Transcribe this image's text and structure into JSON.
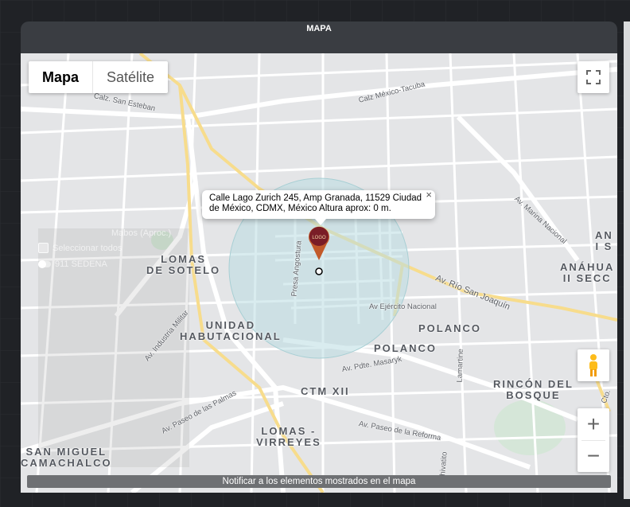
{
  "modal": {
    "title": "MAPA"
  },
  "map_type": {
    "map_label": "Mapa",
    "satellite_label": "Satélite",
    "active": "Mapa"
  },
  "info_window": {
    "line1": "Calle Lago Zurich 245, Amp Granada, 11529 Ciudad",
    "line2": "de México, CDMX, México Altura aprox: 0 m.",
    "close": "×"
  },
  "overlay": {
    "select_all": "Seleccionar todos",
    "layer": "911 SEDENA",
    "layer_label": "Mabos (Aproc.)"
  },
  "bottom_bar": {
    "label": "Notificar a los elementos mostrados en el mapa"
  },
  "zoom": {
    "in": "+",
    "out": "−"
  },
  "neighborhoods": [
    {
      "text": "LOMAS\nDE SOTELO"
    },
    {
      "text": "UNIDAD\nHABUTACIONAL"
    },
    {
      "text": "POLANCO"
    },
    {
      "text": "POLANCO"
    },
    {
      "text": "CTM XII"
    },
    {
      "text": "LOMAS -\nVIRREYES"
    },
    {
      "text": "SAN MIGUEL\nCAMACHALCO"
    },
    {
      "text": "RINCÓN DEL\nBOSQUE"
    },
    {
      "text": "ANÁHUA\nII SECC"
    },
    {
      "text": "AN\nI S"
    }
  ],
  "streets": [
    {
      "text": "Calz. San Esteban"
    },
    {
      "text": "Calz México-Tacuba"
    },
    {
      "text": "Av. Marina Nacional"
    },
    {
      "text": "Av. Río San Joaquín"
    },
    {
      "text": "Av Ejército Nacional"
    },
    {
      "text": "Presa Angostura"
    },
    {
      "text": "Av. Industria Militar"
    },
    {
      "text": "Av. Paseo de las Palmas"
    },
    {
      "text": "Av. Pdte. Masaryk"
    },
    {
      "text": "Av. Paseo de la Reforma"
    },
    {
      "text": "Lamartine"
    },
    {
      "text": "Chivatito"
    },
    {
      "text": "Cto."
    }
  ],
  "colors": {
    "marker": "#7a1d27",
    "radius_fill": "#b9dde2",
    "highway": "#f7dc8c",
    "modal_bg": "#3a3d42"
  }
}
